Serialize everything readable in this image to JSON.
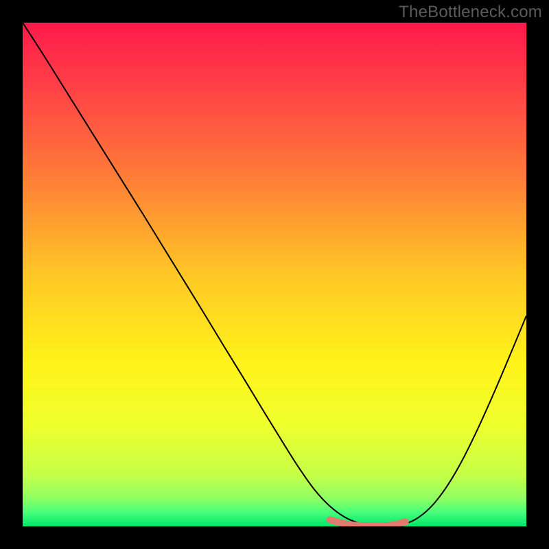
{
  "watermark": "TheBottleneck.com",
  "chart_data": {
    "type": "line",
    "title": "",
    "xlabel": "",
    "ylabel": "",
    "xlim": [
      0,
      100
    ],
    "ylim": [
      0,
      100
    ],
    "background_gradient": {
      "stops": [
        {
          "offset": 0.0,
          "color": "#ff1a4b"
        },
        {
          "offset": 0.12,
          "color": "#ff3e47"
        },
        {
          "offset": 0.3,
          "color": "#ff7a38"
        },
        {
          "offset": 0.5,
          "color": "#ffc726"
        },
        {
          "offset": 0.68,
          "color": "#fff419"
        },
        {
          "offset": 0.8,
          "color": "#eeff2e"
        },
        {
          "offset": 0.9,
          "color": "#c4ff49"
        },
        {
          "offset": 0.945,
          "color": "#8eff63"
        },
        {
          "offset": 0.97,
          "color": "#4dff7a"
        },
        {
          "offset": 1.0,
          "color": "#00e66b"
        }
      ]
    },
    "series": [
      {
        "name": "bottleneck-curve",
        "color": "#000000",
        "x": [
          0.0,
          4,
          8,
          12,
          16,
          20,
          24,
          28,
          32,
          36,
          40,
          44,
          48,
          52,
          55,
          58,
          61,
          64,
          67,
          70,
          72,
          75,
          78,
          81,
          84,
          87,
          90,
          93,
          96,
          100
        ],
        "y": [
          100,
          93.8,
          87.4,
          81.0,
          74.6,
          68.2,
          61.8,
          55.3,
          48.8,
          42.3,
          35.7,
          29.2,
          22.6,
          16.1,
          11.4,
          7.2,
          4.0,
          1.8,
          0.6,
          0.1,
          0.0,
          0.3,
          1.4,
          3.8,
          7.6,
          12.6,
          18.6,
          25.2,
          32.2,
          41.8
        ]
      },
      {
        "name": "optimal-zone",
        "color": "#e47a6f",
        "stroke_width": 10,
        "linecap": "round",
        "x": [
          61,
          64,
          67,
          70,
          73,
          76
        ],
        "y": [
          1.3,
          0.5,
          0.15,
          0.05,
          0.2,
          0.9
        ]
      }
    ]
  }
}
